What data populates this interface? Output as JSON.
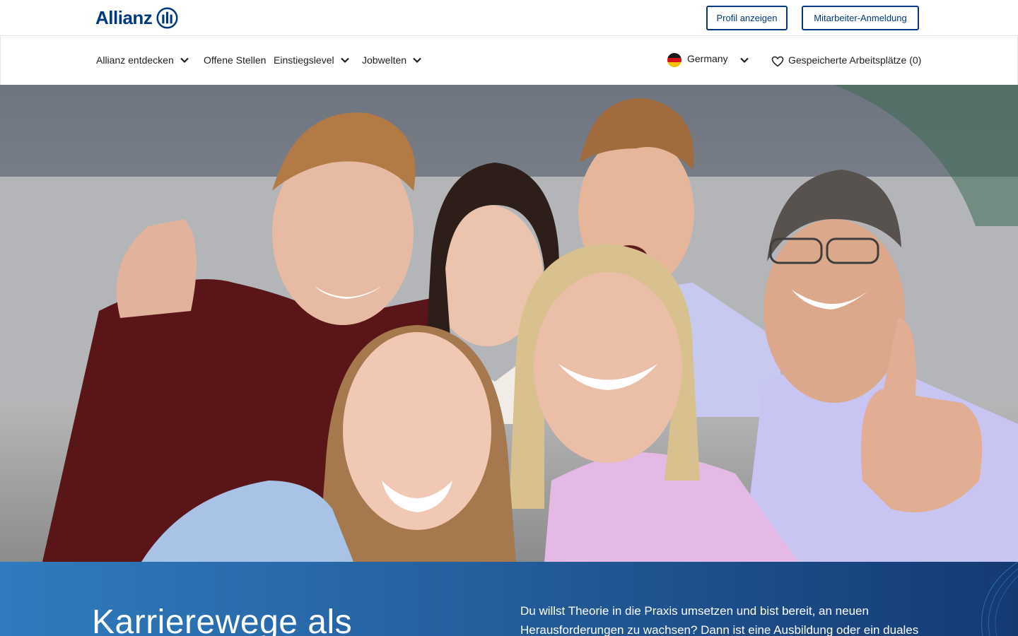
{
  "header": {
    "logo_text": "Allianz",
    "brand_color": "#003781",
    "profile_button": "Profil anzeigen",
    "employee_login_button": "Mitarbeiter-Anmeldung"
  },
  "nav": {
    "items": [
      {
        "label": "Allianz entdecken",
        "has_dropdown": true
      },
      {
        "label": "Offene Stellen",
        "has_dropdown": false
      },
      {
        "label": "Einstiegslevel",
        "has_dropdown": true
      },
      {
        "label": "Jobwelten",
        "has_dropdown": true
      }
    ],
    "country": {
      "label": "Germany",
      "flag_icon": "germany-flag-icon"
    },
    "saved_jobs": {
      "label": "Gespeicherte Arbeitsplätze (0)",
      "icon": "heart-icon"
    }
  },
  "hero": {
    "image_icon": "group-photo"
  },
  "intro": {
    "title": "Karrierewege als",
    "text": "Du willst Theorie in die Praxis umsetzen und bist bereit, an neuen Herausforderungen zu wachsen? Dann ist eine Ausbildung oder ein duales",
    "gradient_start": "#2f7bbd",
    "gradient_end": "#143a73"
  }
}
